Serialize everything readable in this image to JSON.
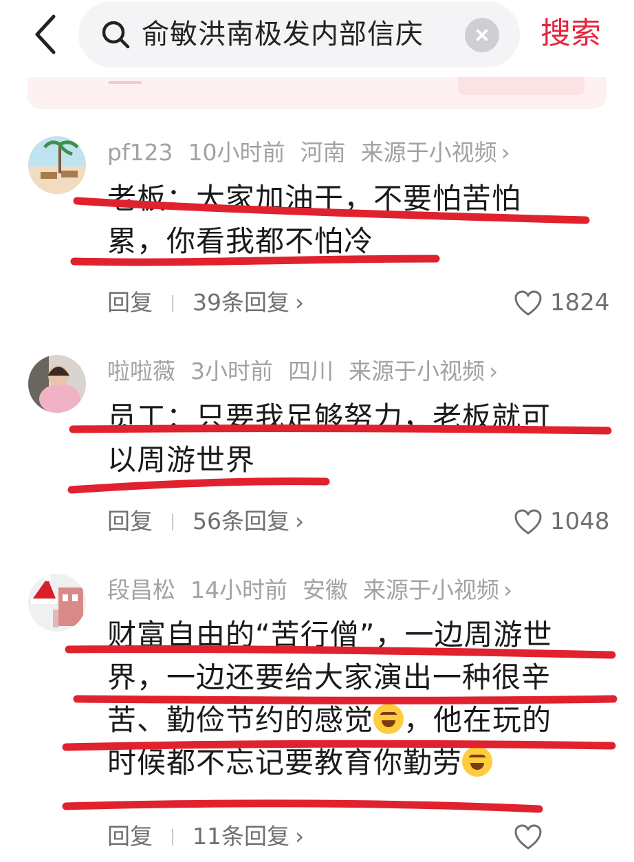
{
  "search": {
    "query": "俞敏洪南极发内部信庆",
    "button_label": "搜索"
  },
  "comments": [
    {
      "user": "pf123",
      "time": "10小时前",
      "region": "河南",
      "source": "来源于小视频",
      "lines": [
        "老板：大家加油干，不要怕苦怕",
        "累，你看我都不怕冷"
      ],
      "reply_label": "回复",
      "replies": "39条回复",
      "likes": "1824"
    },
    {
      "user": "啦啦薇",
      "time": "3小时前",
      "region": "四川",
      "source": "来源于小视频",
      "lines": [
        "员工：只要我足够努力，老板就可",
        "以周游世界"
      ],
      "reply_label": "回复",
      "replies": "56条回复",
      "likes": "1048"
    },
    {
      "user": "段昌松",
      "time": "14小时前",
      "region": "安徽",
      "source": "来源于小视频",
      "lines": [
        "财富自由的“苦行僧”，一边周游世",
        "界，一边还要给大家演出一种很辛",
        "苦、勤俭节约的感觉",
        "，他在玩的",
        "时候都不忘记要教育你勤劳"
      ],
      "reply_label": "回复",
      "replies": "11条回复"
    }
  ],
  "chevron": "›",
  "icons": [
    "back-arrow-icon",
    "search-icon",
    "clear-icon",
    "heart-icon",
    "chevron-right-icon",
    "crying-laughing-emoji",
    "laughing-emoji"
  ],
  "colors": {
    "accent": "#e3263f",
    "annotation": "#e0222e",
    "meta": "#a1a1a6"
  }
}
